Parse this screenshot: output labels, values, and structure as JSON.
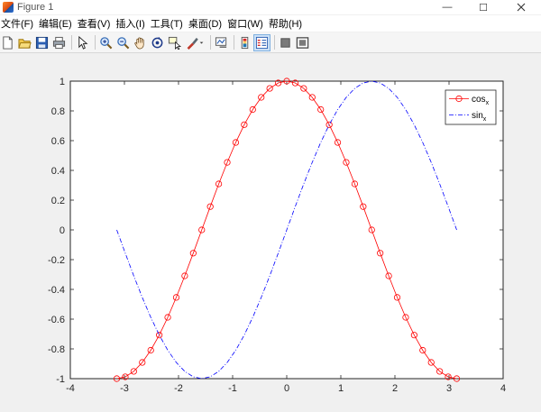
{
  "window": {
    "title": "Figure 1",
    "minimize_glyph": "—",
    "maximize_glyph": "☐"
  },
  "menu": [
    {
      "label": "文件(F)"
    },
    {
      "label": "编辑(E)"
    },
    {
      "label": "查看(V)"
    },
    {
      "label": "插入(I)"
    },
    {
      "label": "工具(T)"
    },
    {
      "label": "桌面(D)"
    },
    {
      "label": "窗口(W)"
    },
    {
      "label": "帮助(H)"
    }
  ],
  "toolbar": {
    "buttons": [
      {
        "icon": "new-figure-icon"
      },
      {
        "icon": "open-file-icon"
      },
      {
        "icon": "save-icon"
      },
      {
        "icon": "print-icon"
      },
      {
        "icon": "pointer-icon"
      },
      {
        "icon": "zoom-in-icon"
      },
      {
        "icon": "zoom-out-icon"
      },
      {
        "icon": "pan-hand-icon"
      },
      {
        "icon": "rotate-3d-icon"
      },
      {
        "icon": "data-cursor-icon"
      },
      {
        "icon": "brush-icon"
      },
      {
        "icon": "link-plot-icon"
      },
      {
        "icon": "colorbar-icon"
      },
      {
        "icon": "legend-icon"
      },
      {
        "icon": "hide-plot-tools-icon"
      },
      {
        "icon": "show-plot-tools-icon"
      }
    ]
  },
  "chart_data": {
    "type": "line",
    "xlim": [
      -4,
      4
    ],
    "ylim": [
      -1,
      1
    ],
    "xticks": [
      "-4",
      "-3",
      "-2",
      "-1",
      "0",
      "1",
      "2",
      "3",
      "4"
    ],
    "yticks": [
      "-1",
      "-0.8",
      "-0.6",
      "-0.4",
      "-0.2",
      "0",
      "0.2",
      "0.4",
      "0.6",
      "0.8",
      "1"
    ],
    "grid": false,
    "legend_position": "top-right",
    "series": [
      {
        "name": "cos",
        "name_subscript": "x",
        "function": "cos",
        "x_start": -3.1416,
        "x_end": 3.1416,
        "num_points": 41,
        "color": "#ff0000",
        "line_style": "solid",
        "marker": "circle"
      },
      {
        "name": "sin",
        "name_subscript": "x",
        "function": "sin",
        "x_start": -3.1416,
        "x_end": 3.1416,
        "num_points": 41,
        "color": "#0000ff",
        "line_style": "dash-dot",
        "marker": "none"
      }
    ]
  }
}
